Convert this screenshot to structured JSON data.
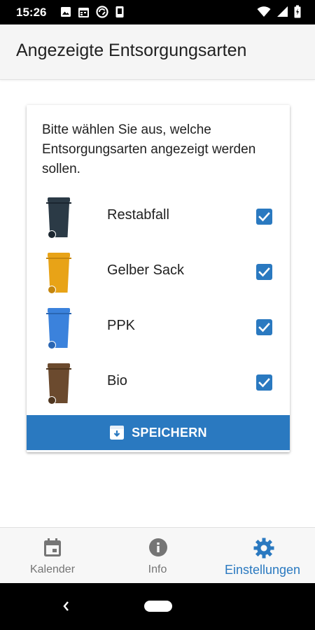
{
  "status_bar": {
    "time": "15:26",
    "left_icons": [
      "image-icon",
      "calendar-icon",
      "sync-icon",
      "phone-icon"
    ],
    "right_icons": [
      "wifi-icon",
      "signal-icon",
      "battery-icon"
    ]
  },
  "app_bar": {
    "title": "Angezeigte Entsorgungsarten"
  },
  "card": {
    "intro": "Bitte wählen Sie aus, welche Entsorgungsarten angezeigt werden sollen.",
    "options": [
      {
        "label": "Restabfall",
        "checked": true,
        "bin_color": "#2b3a46"
      },
      {
        "label": "Gelber Sack",
        "checked": true,
        "bin_color": "#e8a317"
      },
      {
        "label": "PPK",
        "checked": true,
        "bin_color": "#3b82dc"
      },
      {
        "label": "Bio",
        "checked": true,
        "bin_color": "#6b4a2e"
      }
    ],
    "save_label": "SPEICHERN"
  },
  "bottom_nav": {
    "items": [
      {
        "label": "Kalender",
        "icon": "calendar-icon",
        "active": false
      },
      {
        "label": "Info",
        "icon": "info-icon",
        "active": false
      },
      {
        "label": "Einstellungen",
        "icon": "gear-icon",
        "active": true
      }
    ]
  },
  "colors": {
    "accent": "#2a79c0",
    "inactive": "#757575"
  }
}
